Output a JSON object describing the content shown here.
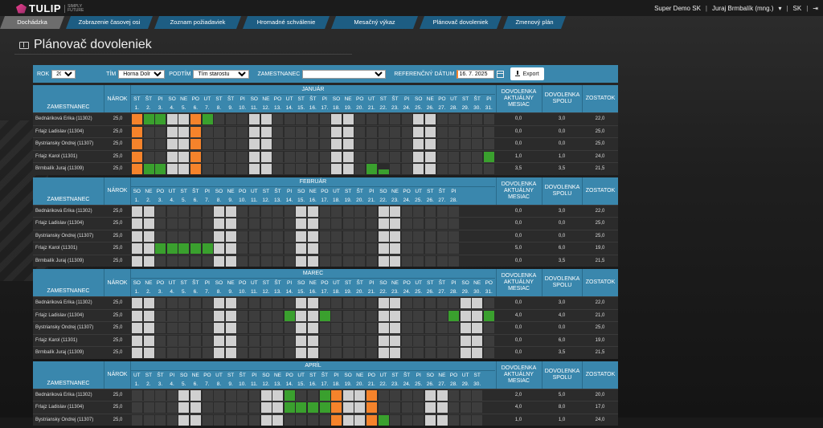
{
  "app": {
    "name": "TULIP",
    "tagline": "SIMPLY FUTURE"
  },
  "topnav": {
    "company": "Super Demo SK",
    "user": "Juraj Brmbalík (mng.)",
    "lang": "SK"
  },
  "tabs": [
    {
      "label": "Dochádzka",
      "active": true
    },
    {
      "label": "Zobrazenie časovej osi",
      "active": false
    },
    {
      "label": "Zoznam požiadaviek",
      "active": false
    },
    {
      "label": "Hromadné schválenie",
      "active": false
    },
    {
      "label": "Mesačný výkaz",
      "active": false
    },
    {
      "label": "Plánovač dovoleniek",
      "active": false
    },
    {
      "label": "Zmenový plán",
      "active": false
    }
  ],
  "page_title": "Plánovač dovoleniek",
  "filters": {
    "rok_label": "ROK",
    "rok_value": "2025",
    "tim_label": "TÍM",
    "tim_value": "Horna Dolna",
    "podtim_label": "PODTÍM",
    "podtim_value": "Tím starostu",
    "zamestnanec_label": "ZAMESTNANEC",
    "zamestnanec_value": "",
    "ref_label": "REFERENČNÝ DÁTUM",
    "ref_value": "16. 7. 2025",
    "export_label": "Export"
  },
  "columns": {
    "employee": "ZAMESTNANEC",
    "entitlement": "NÁROK",
    "month_vacation": "DOVOLENKA AKTUÁLNY MESIAC",
    "total_vacation": "DOVOLENKA SPOLU",
    "remaining": "ZOSTATOK"
  },
  "months": [
    {
      "name": "JANUÁR",
      "days": [
        "ST",
        "ŠT",
        "PI",
        "SO",
        "NE",
        "PO",
        "UT",
        "ST",
        "ŠT",
        "PI",
        "SO",
        "NE",
        "PO",
        "UT",
        "ST",
        "ŠT",
        "PI",
        "SO",
        "NE",
        "PO",
        "UT",
        "ST",
        "ŠT",
        "PI",
        "SO",
        "NE",
        "PO",
        "UT",
        "ST",
        "ŠT",
        "PI"
      ],
      "rows": [
        {
          "name": "Bednáriková Erika (11302)",
          "narok": "25,0",
          "month": "0,0",
          "total": "3,0",
          "remain": "22,0",
          "marks": {
            "0": "h",
            "1": "v",
            "2": "v",
            "5": "h",
            "6": "v"
          }
        },
        {
          "name": "Frlajz Ladislav (11304)",
          "narok": "25,0",
          "month": "0,0",
          "total": "0,0",
          "remain": "25,0",
          "marks": {
            "0": "h",
            "5": "h"
          }
        },
        {
          "name": "Bystriansky Ondrej (11307)",
          "narok": "25,0",
          "month": "0,0",
          "total": "0,0",
          "remain": "25,0",
          "marks": {
            "0": "h",
            "5": "h"
          }
        },
        {
          "name": "Frlajz Karol (11301)",
          "narok": "25,0",
          "month": "1,0",
          "total": "1,0",
          "remain": "24,0",
          "marks": {
            "0": "h",
            "5": "h",
            "30": "v"
          }
        },
        {
          "name": "Brmbalík Juraj (11309)",
          "narok": "25,0",
          "month": "3,5",
          "total": "3,5",
          "remain": "21,5",
          "marks": {
            "0": "h",
            "1": "v",
            "2": "v",
            "5": "h",
            "20": "v",
            "21": "p"
          }
        }
      ]
    },
    {
      "name": "FEBRUÁR",
      "days": [
        "SO",
        "NE",
        "PO",
        "UT",
        "ST",
        "ŠT",
        "PI",
        "SO",
        "NE",
        "PO",
        "UT",
        "ST",
        "ŠT",
        "PI",
        "SO",
        "NE",
        "PO",
        "UT",
        "ST",
        "ŠT",
        "PI",
        "SO",
        "NE",
        "PO",
        "UT",
        "ST",
        "ŠT",
        "PI"
      ],
      "rows": [
        {
          "name": "Bednáriková Erika (11302)",
          "narok": "25,0",
          "month": "0,0",
          "total": "3,0",
          "remain": "22,0",
          "marks": {}
        },
        {
          "name": "Frlajz Ladislav (11304)",
          "narok": "25,0",
          "month": "0,0",
          "total": "0,0",
          "remain": "25,0",
          "marks": {}
        },
        {
          "name": "Bystriansky Ondrej (11307)",
          "narok": "25,0",
          "month": "0,0",
          "total": "0,0",
          "remain": "25,0",
          "marks": {}
        },
        {
          "name": "Frlajz Karol (11301)",
          "narok": "25,0",
          "month": "5,0",
          "total": "6,0",
          "remain": "19,0",
          "marks": {
            "2": "v",
            "3": "v",
            "4": "v",
            "5": "v",
            "6": "v"
          }
        },
        {
          "name": "Brmbalík Juraj (11309)",
          "narok": "25,0",
          "month": "0,0",
          "total": "3,5",
          "remain": "21,5",
          "marks": {}
        }
      ]
    },
    {
      "name": "MAREC",
      "days": [
        "SO",
        "NE",
        "PO",
        "UT",
        "ST",
        "ŠT",
        "PI",
        "SO",
        "NE",
        "PO",
        "UT",
        "ST",
        "ŠT",
        "PI",
        "SO",
        "NE",
        "PO",
        "UT",
        "ST",
        "ŠT",
        "PI",
        "SO",
        "NE",
        "PO",
        "UT",
        "ST",
        "ŠT",
        "PI",
        "SO",
        "NE",
        "PO"
      ],
      "rows": [
        {
          "name": "Bednáriková Erika (11302)",
          "narok": "25,0",
          "month": "0,0",
          "total": "3,0",
          "remain": "22,0",
          "marks": {}
        },
        {
          "name": "Frlajz Ladislav (11304)",
          "narok": "25,0",
          "month": "4,0",
          "total": "4,0",
          "remain": "21,0",
          "marks": {
            "13": "v",
            "16": "v",
            "27": "v",
            "30": "v"
          }
        },
        {
          "name": "Bystriansky Ondrej (11307)",
          "narok": "25,0",
          "month": "0,0",
          "total": "0,0",
          "remain": "25,0",
          "marks": {}
        },
        {
          "name": "Frlajz Karol (11301)",
          "narok": "25,0",
          "month": "0,0",
          "total": "6,0",
          "remain": "19,0",
          "marks": {}
        },
        {
          "name": "Brmbalík Juraj (11309)",
          "narok": "25,0",
          "month": "0,0",
          "total": "3,5",
          "remain": "21,5",
          "marks": {}
        }
      ]
    },
    {
      "name": "APRÍL",
      "days": [
        "UT",
        "ST",
        "ŠT",
        "PI",
        "SO",
        "NE",
        "PO",
        "UT",
        "ST",
        "ŠT",
        "PI",
        "SO",
        "NE",
        "PO",
        "UT",
        "ST",
        "ŠT",
        "PI",
        "SO",
        "NE",
        "PO",
        "UT",
        "ST",
        "ŠT",
        "PI",
        "SO",
        "NE",
        "PO",
        "UT",
        "ST"
      ],
      "rows": [
        {
          "name": "Bednáriková Erika (11302)",
          "narok": "25,0",
          "month": "2,0",
          "total": "5,0",
          "remain": "20,0",
          "marks": {
            "13": "v",
            "16": "v",
            "17": "h",
            "20": "h"
          }
        },
        {
          "name": "Frlajz Ladislav (11304)",
          "narok": "25,0",
          "month": "4,0",
          "total": "8,0",
          "remain": "17,0",
          "marks": {
            "13": "v",
            "14": "v",
            "15": "v",
            "16": "v",
            "17": "h",
            "20": "h"
          }
        },
        {
          "name": "Bystriansky Ondrej (11307)",
          "narok": "25,0",
          "month": "1,0",
          "total": "1,0",
          "remain": "24,0",
          "marks": {
            "17": "h",
            "20": "h",
            "21": "v"
          }
        }
      ]
    }
  ]
}
